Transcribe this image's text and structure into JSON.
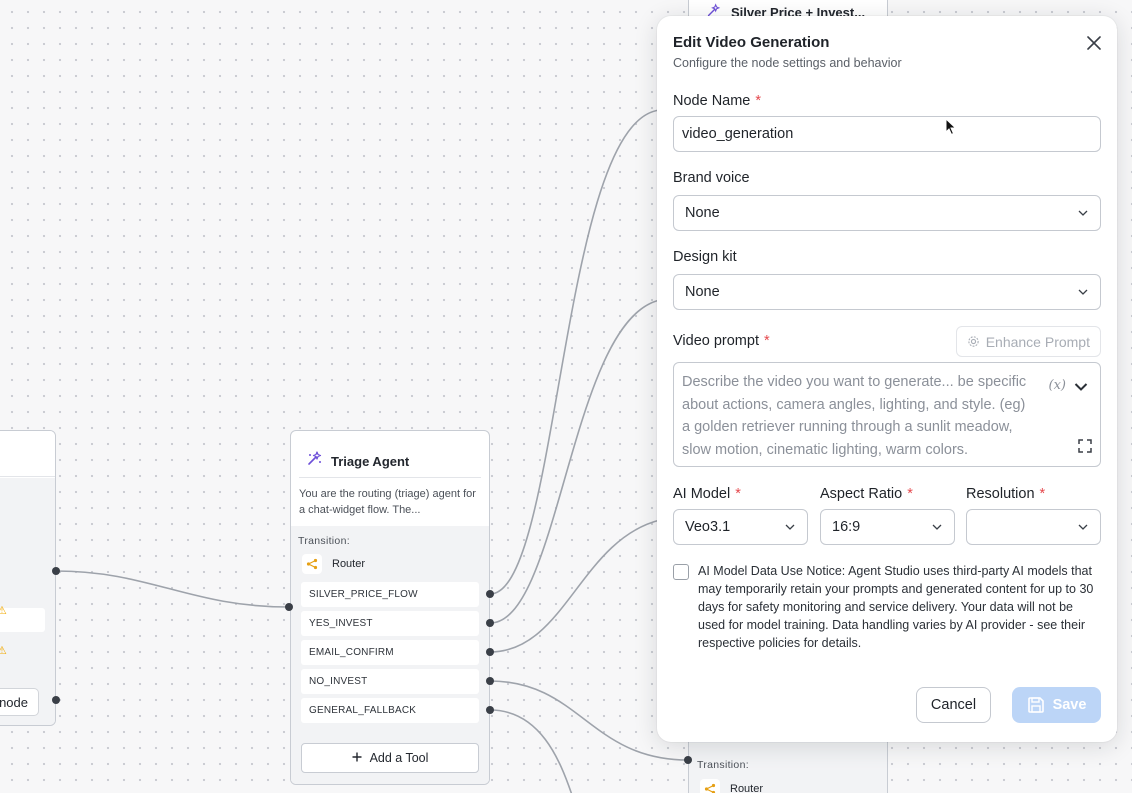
{
  "canvas": {
    "left_node": {
      "add_label": "node"
    },
    "triage": {
      "title": "Triage Agent",
      "icon": "sparkle-icon",
      "description": "You are the routing (triage) agent for a chat-widget flow. The...",
      "transition_label": "Transition:",
      "router_label": "Router",
      "routes": [
        "SILVER_PRICE_FLOW",
        "YES_INVEST",
        "EMAIL_CONFIRM",
        "NO_INVEST",
        "GENERAL_FALLBACK"
      ],
      "add_tool_label": "Add a Tool"
    },
    "right_node": {
      "title": "Silver Price + Invest...",
      "transition_label": "Transition:",
      "router_label": "Router"
    }
  },
  "panel": {
    "title": "Edit Video Generation",
    "subtitle": "Configure the node settings and behavior",
    "node_name_label": "Node Name",
    "node_name_value": "video_generation",
    "brand_voice_label": "Brand voice",
    "brand_voice_value": "None",
    "design_kit_label": "Design kit",
    "design_kit_value": "None",
    "video_prompt_label": "Video prompt",
    "enhance_label": "Enhance Prompt",
    "video_prompt_placeholder": "Describe the video you want to generate... be specific about actions, camera angles, lighting, and style. (eg) a golden retriever running through a sunlit meadow, slow motion, cinematic lighting, warm colors.",
    "variable_token": "(x)",
    "ai_model_label": "AI Model",
    "ai_model_value": "Veo3.1",
    "aspect_ratio_label": "Aspect Ratio",
    "aspect_ratio_value": "16:9",
    "resolution_label": "Resolution",
    "resolution_value": "",
    "required_mark": "*",
    "notice": "AI Model Data Use Notice: Agent Studio uses third-party AI models that may temporarily retain your prompts and generated content for up to 30 days for safety monitoring and service delivery. Your data will not be used for model training. Data handling varies by AI provider - see their respective policies for details.",
    "cancel_label": "Cancel",
    "save_label": "Save"
  },
  "colors": {
    "accent_disabled": "#bcd5f7",
    "required": "#e5484d",
    "agent_icon": "#6d4fd8",
    "router_icon": "#e6a015"
  }
}
